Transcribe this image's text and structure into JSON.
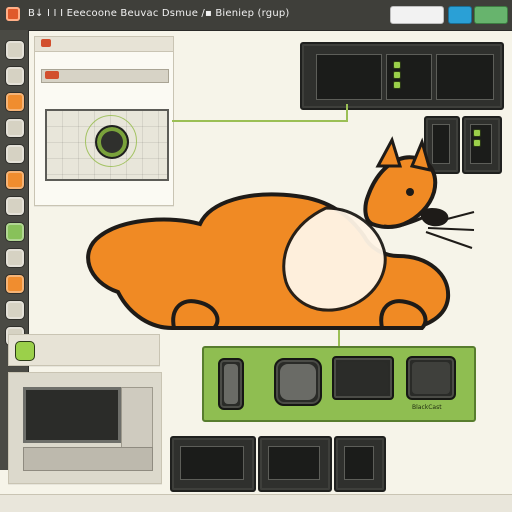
{
  "topbar": {
    "title": "B↓ Ⅰ Ⅰ Ⅰ  Eeecoone  Beuvac  Dsmue  /▪  Bieniep  (rgup)"
  },
  "left_pane_top": {
    "header": "",
    "red_label": "",
    "small_caption_1": "",
    "small_caption_2": "",
    "mini_text_1": "",
    "mini_text_2": ""
  },
  "left_info": {
    "title_line": "",
    "desc_1": "",
    "desc_2": "",
    "desc_3": "",
    "desc_4": ""
  },
  "bottom_left_card": {
    "title": "",
    "subtitle": ""
  },
  "green_strip": {
    "caption": "",
    "right_caption": "BlackCast"
  },
  "bottom_bar": {
    "left_text": "",
    "center_text": "",
    "right_text": ""
  },
  "colors": {
    "cat_orange": "#F08A24",
    "cat_outline": "#1E1B18",
    "cat_cream": "#FFF5E6",
    "accent_green": "#9BBF55",
    "accent_red": "#D24F2D"
  },
  "icons": {
    "app": "app-icon",
    "sidebar": [
      "tool-icon",
      "tool-icon",
      "tool-icon",
      "tool-icon",
      "tool-icon",
      "tool-icon",
      "tool-icon",
      "tool-icon",
      "tool-icon",
      "tool-icon",
      "tool-icon",
      "tool-icon"
    ]
  }
}
